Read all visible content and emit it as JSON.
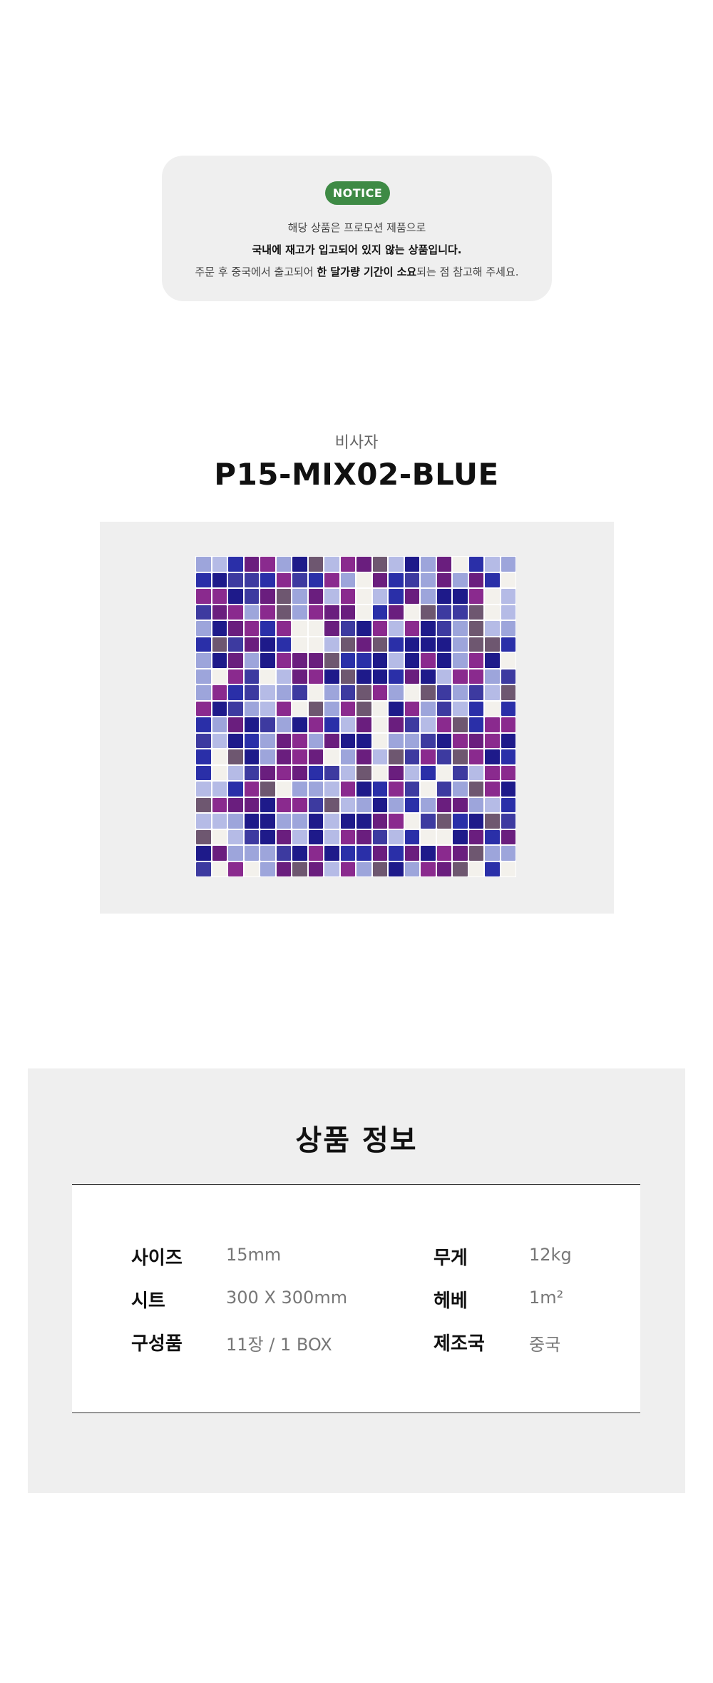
{
  "notice": {
    "badge": "NOTICE",
    "line1": "해당 상품은 프로모션 제품으로",
    "line2": "국내에 재고가 입고되어 있지 않는 상품입니다.",
    "line3_a": "주문 후 중국에서 출고되어 ",
    "line3_bold": "한 달가량 기간이 소요",
    "line3_b": "되는 점 참고해 주세요."
  },
  "product": {
    "brand": "비사자",
    "code": "P15-MIX02-BLUE",
    "image_icon": "mosaic-tile-sheet",
    "tile_colors": [
      "#1e1a8a",
      "#2a2fa8",
      "#6a1e7e",
      "#8a2a8e",
      "#9da5db",
      "#b5bbe6",
      "#f3f1ec",
      "#6e5770",
      "#3d3aa0"
    ]
  },
  "info": {
    "title": "상품 정보",
    "specs": [
      {
        "label": "사이즈",
        "value": "15mm"
      },
      {
        "label": "무게",
        "value": "12kg"
      },
      {
        "label": "시트",
        "value": "300 X 300mm"
      },
      {
        "label": "헤베",
        "value": "1m²"
      },
      {
        "label": "구성품",
        "value": "11장 / 1 BOX"
      },
      {
        "label": "제조국",
        "value": "중국"
      }
    ]
  }
}
